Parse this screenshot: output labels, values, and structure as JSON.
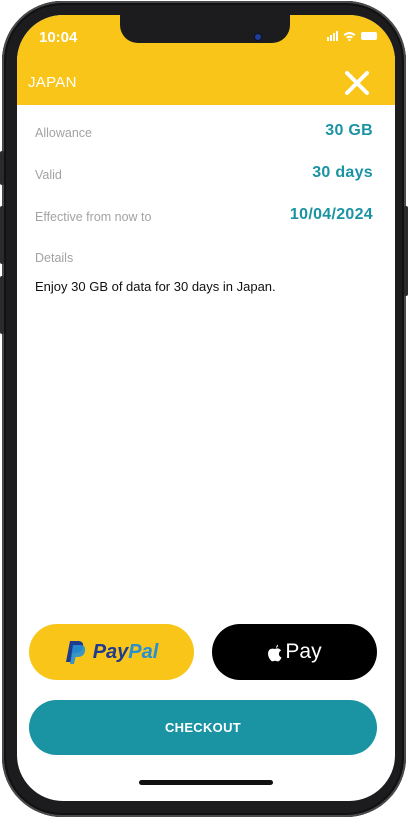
{
  "status_bar": {
    "time": "10:04"
  },
  "header": {
    "title": "JAPAN",
    "close_icon": "close-icon",
    "background": "#f8c518"
  },
  "plan": {
    "allowance_label": "Allowance",
    "allowance_value": "30 GB",
    "valid_label": "Valid",
    "valid_value": "30 days",
    "effective_label": "Effective from now to",
    "effective_value": "10/04/2024",
    "details_label": "Details",
    "details_text": "Enjoy 30 GB of data for 30 days in Japan."
  },
  "payment": {
    "paypal_label_1": "Pay",
    "paypal_label_2": "Pal",
    "applepay_label": "Pay",
    "checkout_label": "CHECKOUT"
  },
  "colors": {
    "accent": "#1a93a3",
    "header": "#f8c518",
    "label": "#a3a3a3"
  }
}
